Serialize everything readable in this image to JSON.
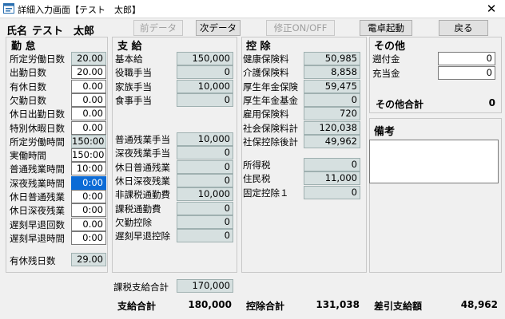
{
  "window": {
    "title": "詳細入力画面【テスト　太郎】",
    "close_glyph": "✕"
  },
  "header": {
    "name_label": "氏名",
    "name_value": "テスト　太郎",
    "buttons": {
      "prev": "前データ",
      "next": "次データ",
      "fix": "修正ON/OFF",
      "calc": "電卓起動",
      "back": "戻る"
    }
  },
  "attendance": {
    "title": "勤 怠",
    "rows": [
      {
        "label": "所定労働日数",
        "value": "20.00"
      },
      {
        "label": "出勤日数",
        "value": "20.00"
      },
      {
        "label": "有休日数",
        "value": "0.00"
      },
      {
        "label": "欠勤日数",
        "value": "0.00"
      },
      {
        "label": "休日出勤日数",
        "value": "0.00"
      },
      {
        "label": "特別休暇日数",
        "value": "0.00"
      },
      {
        "label": "所定労働時間",
        "value": "150:00"
      },
      {
        "label": "実働時間",
        "value": "150:00"
      },
      {
        "label": "普通残業時間",
        "value": "10:00"
      },
      {
        "label": "深夜残業時間",
        "value": "0:00"
      },
      {
        "label": "休日普通残業",
        "value": "0:00"
      },
      {
        "label": "休日深夜残業",
        "value": "0:00"
      },
      {
        "label": "遅刻早退回数",
        "value": "0.00"
      },
      {
        "label": "遅刻早退時間",
        "value": "0:00"
      }
    ],
    "paid_leave_label": "有休残日数",
    "paid_leave_value": "29.00"
  },
  "payment": {
    "title": "支 給",
    "rows_top": [
      {
        "label": "基本給",
        "value": "150,000"
      },
      {
        "label": "役職手当",
        "value": "0"
      },
      {
        "label": "家族手当",
        "value": "10,000"
      },
      {
        "label": "食事手当",
        "value": "0"
      }
    ],
    "rows_bottom": [
      {
        "label": "普通残業手当",
        "value": "10,000"
      },
      {
        "label": "深夜残業手当",
        "value": "0"
      },
      {
        "label": "休日普通残業",
        "value": "0"
      },
      {
        "label": "休日深夜残業",
        "value": "0"
      },
      {
        "label": "非課税通勤費",
        "value": "10,000"
      },
      {
        "label": "課税通勤費",
        "value": "0"
      },
      {
        "label": "欠勤控除",
        "value": "0"
      },
      {
        "label": "遅刻早退控除",
        "value": "0"
      }
    ],
    "taxable_total_label": "課税支給合計",
    "taxable_total_value": "170,000",
    "total_label": "支給合計",
    "total_value": "180,000"
  },
  "deduction": {
    "title": "控 除",
    "rows_top": [
      {
        "label": "健康保険料",
        "value": "50,985"
      },
      {
        "label": "介護保険料",
        "value": "8,858"
      },
      {
        "label": "厚生年金保険",
        "value": "59,475"
      },
      {
        "label": "厚生年金基金",
        "value": "0"
      },
      {
        "label": "雇用保険料",
        "value": "720"
      },
      {
        "label": "社会保険料計",
        "value": "120,038"
      },
      {
        "label": "社保控除後計",
        "value": "49,962"
      }
    ],
    "rows_bottom": [
      {
        "label": "所得税",
        "value": "0"
      },
      {
        "label": "住民税",
        "value": "11,000"
      },
      {
        "label": "固定控除１",
        "value": "0"
      }
    ],
    "total_label": "控除合計",
    "total_value": "131,038"
  },
  "other": {
    "title": "その他",
    "rows": [
      {
        "label": "遡付金",
        "value": "0"
      },
      {
        "label": "充当金",
        "value": "0"
      }
    ],
    "total_label": "その他合計",
    "total_value": "0",
    "remarks_label": "備考",
    "remarks_value": "",
    "net_label": "差引支給額",
    "net_value": "48,962"
  }
}
